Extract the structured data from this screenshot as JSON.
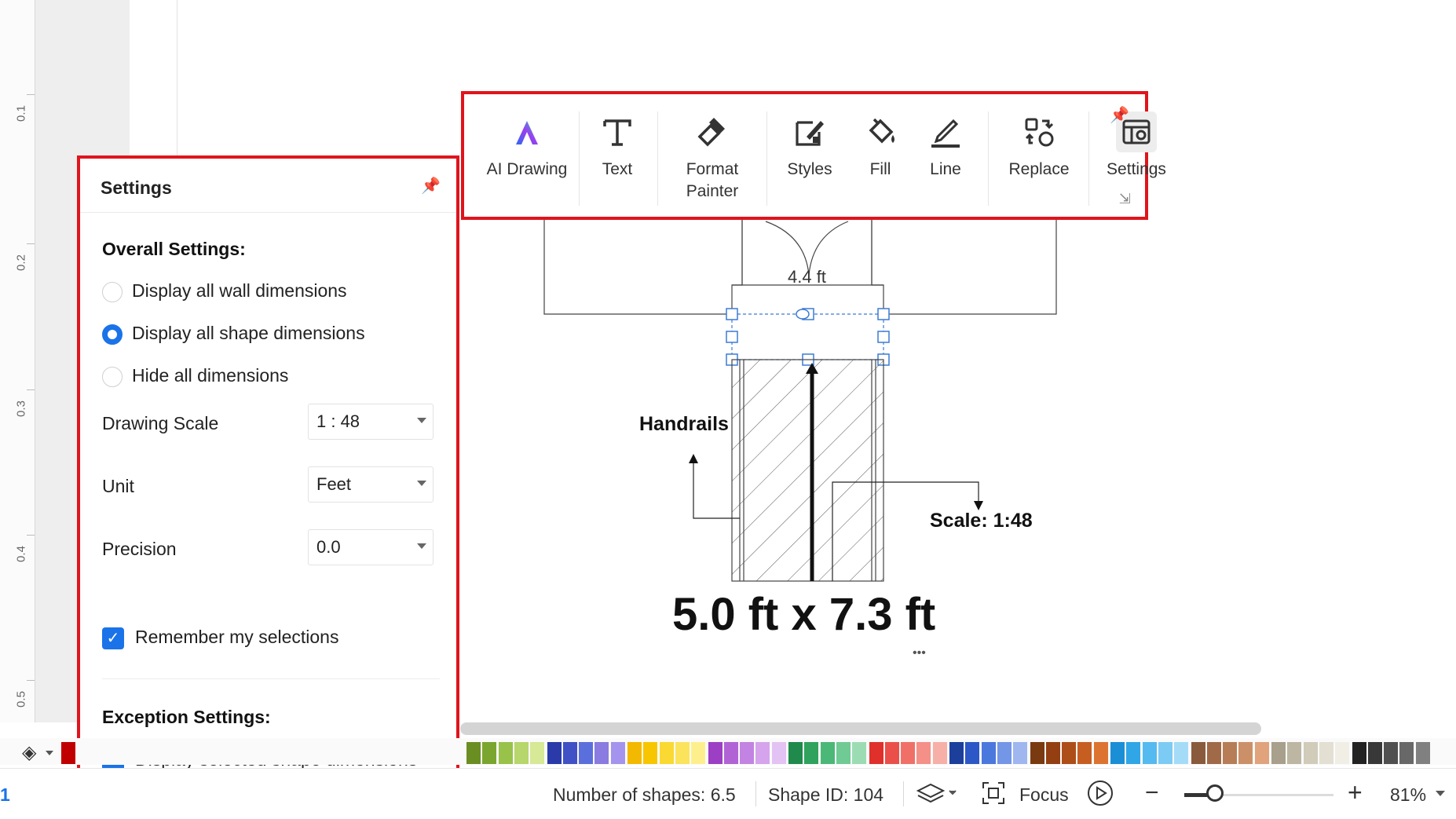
{
  "ruler": {
    "ticks": [
      "0.1",
      "0.2",
      "0.3",
      "0.4",
      "0.5"
    ]
  },
  "toolbar": {
    "tools": [
      {
        "label": "AI Drawing",
        "icon": "ai-drawing-icon"
      },
      {
        "label": "Text",
        "icon": "text-icon"
      },
      {
        "label": "Format\nPainter",
        "icon": "format-painter-icon"
      },
      {
        "label": "Styles",
        "icon": "styles-icon"
      },
      {
        "label": "Fill",
        "icon": "fill-icon"
      },
      {
        "label": "Line",
        "icon": "line-icon"
      },
      {
        "label": "Replace",
        "icon": "replace-icon"
      },
      {
        "label": "Settings",
        "icon": "settings-icon",
        "active": true
      }
    ],
    "format_painter_line1": "Format",
    "format_painter_line2": "Painter"
  },
  "settings": {
    "title": "Settings",
    "overall_title": "Overall Settings:",
    "options": [
      {
        "label": "Display all wall dimensions",
        "selected": false
      },
      {
        "label": "Display all shape dimensions",
        "selected": true
      },
      {
        "label": "Hide all dimensions",
        "selected": false
      }
    ],
    "fields": [
      {
        "label": "Drawing Scale",
        "value": "1 : 48"
      },
      {
        "label": "Unit",
        "value": "Feet"
      },
      {
        "label": "Precision",
        "value": "0.0"
      }
    ],
    "remember_label": "Remember my selections",
    "remember_checked": true,
    "exception_title": "Exception Settings:",
    "exception_label": "Display selected shape dimensions",
    "exception_checked": true
  },
  "canvas": {
    "top_dimension": "4.4 ft",
    "handrails_label": "Handrails",
    "scale_label": "Scale: 1:48",
    "size_label": "5.0 ft x 7.3 ft",
    "more_dots": "•••"
  },
  "palette": {
    "colors": [
      "#c00000",
      "#6b8e23",
      "#7aa62f",
      "#98c24a",
      "#b7d66c",
      "#d7e896",
      "#2a3aa8",
      "#3f51c5",
      "#5b6fdc",
      "#8a7be0",
      "#a594ee",
      "#f3b800",
      "#f7c600",
      "#fad933",
      "#fbe35c",
      "#fdf08c",
      "#9c3fc4",
      "#b163d6",
      "#c383e2",
      "#d5a4ec",
      "#e3c3f3",
      "#1f8a4c",
      "#2fa35e",
      "#4bb878",
      "#6fcb93",
      "#9cdcb3",
      "#e0302b",
      "#ea5049",
      "#f07068",
      "#f49088",
      "#f7b0a8",
      "#1c3f9c",
      "#2c58c7",
      "#4b78dd",
      "#7496e6",
      "#9fb6ef",
      "#7a3a10",
      "#933f12",
      "#ad4d18",
      "#c65e21",
      "#dd7330",
      "#1a8fd6",
      "#30a6e6",
      "#55baef",
      "#7ccbf4",
      "#a4dcf8",
      "#8a5a3c",
      "#a06a48",
      "#b67d57",
      "#cc9068",
      "#e0a37c",
      "#a8a08c",
      "#bdb6a3",
      "#d1cbba",
      "#e3dfd2",
      "#f1eee6",
      "#222222",
      "#383838",
      "#505050",
      "#686868",
      "#808080"
    ],
    "fill_icon": "paint-bucket-icon"
  },
  "status": {
    "page_number": "1",
    "shapes": "Number of shapes: 6.5",
    "shape_id": "Shape ID: 104",
    "layers_icon": "layers-icon",
    "focus_label": "Focus",
    "zoom": "81%"
  }
}
